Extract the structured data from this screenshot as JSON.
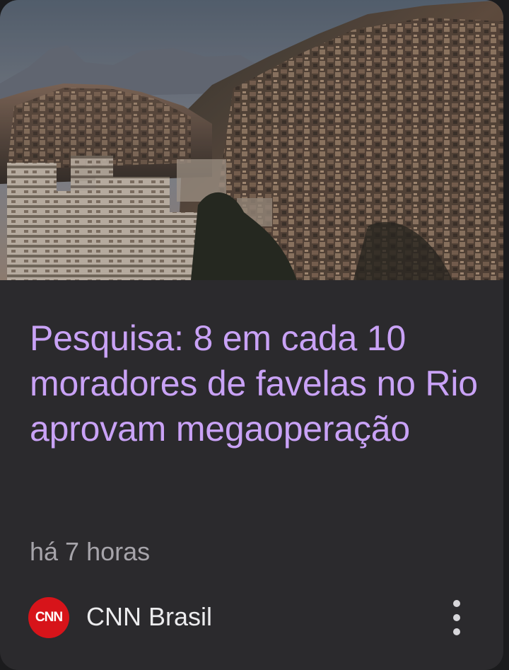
{
  "article": {
    "image": "aerial-photo-rio-favela-hillside",
    "headline": "Pesquisa: 8 em cada 10 moradores de favelas no Rio aprovam megaoperação",
    "time_ago": "há 7 horas",
    "headline_color": "#c9a2f6"
  },
  "source": {
    "name": "CNN Brasil",
    "logo_text": "CNN",
    "logo_color": "#d7141a"
  },
  "menu": {
    "icon": "more-vertical-icon"
  }
}
